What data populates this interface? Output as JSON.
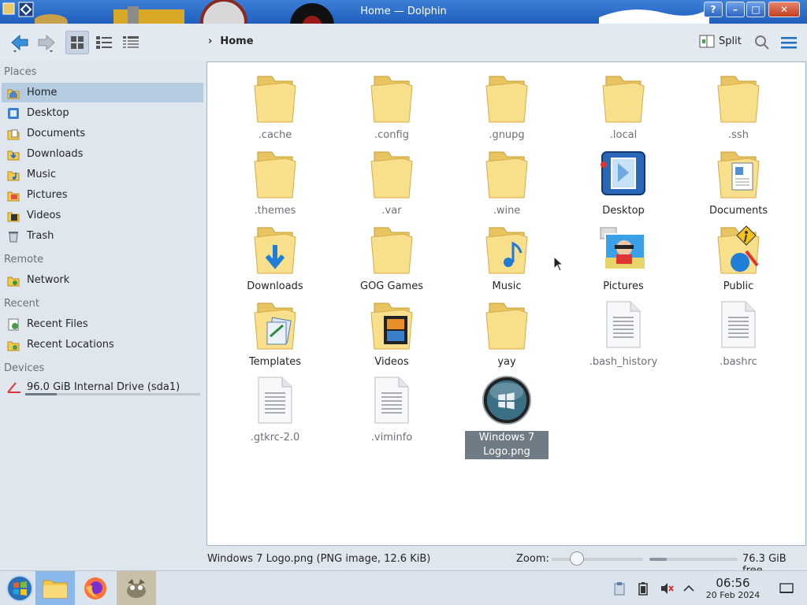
{
  "window": {
    "title": "Home — Dolphin",
    "help_btn": "?",
    "min_btn": "–",
    "max_btn": "□",
    "close_btn": "✕"
  },
  "toolbar": {
    "back_icon": "back-arrow-icon",
    "forward_icon": "forward-arrow-icon",
    "view_modes": [
      "icons-view",
      "compact-view",
      "details-view"
    ],
    "breadcrumb_sep": "›",
    "breadcrumb": "Home",
    "split_label": "Split",
    "search_icon": "search-icon",
    "menu_icon": "hamburger-menu-icon"
  },
  "sidebar": {
    "places_title": "Places",
    "places": [
      "Home",
      "Desktop",
      "Documents",
      "Downloads",
      "Music",
      "Pictures",
      "Videos",
      "Trash"
    ],
    "remote_title": "Remote",
    "remote": [
      "Network"
    ],
    "recent_title": "Recent",
    "recent": [
      "Recent Files",
      "Recent Locations"
    ],
    "devices_title": "Devices",
    "devices": [
      "96.0 GiB Internal Drive (sda1)"
    ],
    "drive_usage_fraction": 0.18
  },
  "files": [
    {
      "name": ".cache",
      "type": "folder",
      "hidden": true
    },
    {
      "name": ".config",
      "type": "folder",
      "hidden": true
    },
    {
      "name": ".gnupg",
      "type": "folder",
      "hidden": true
    },
    {
      "name": ".local",
      "type": "folder",
      "hidden": true
    },
    {
      "name": ".ssh",
      "type": "folder",
      "hidden": true
    },
    {
      "name": ".themes",
      "type": "folder",
      "hidden": true
    },
    {
      "name": ".var",
      "type": "folder",
      "hidden": true
    },
    {
      "name": ".wine",
      "type": "folder",
      "hidden": true
    },
    {
      "name": "Desktop",
      "type": "desktop",
      "hidden": false
    },
    {
      "name": "Documents",
      "type": "documents",
      "hidden": false
    },
    {
      "name": "Downloads",
      "type": "downloads",
      "hidden": false
    },
    {
      "name": "GOG Games",
      "type": "folder",
      "hidden": false
    },
    {
      "name": "Music",
      "type": "music",
      "hidden": false
    },
    {
      "name": "Pictures",
      "type": "pictures",
      "hidden": false
    },
    {
      "name": "Public",
      "type": "public",
      "hidden": false
    },
    {
      "name": "Templates",
      "type": "templates",
      "hidden": false
    },
    {
      "name": "Videos",
      "type": "videos",
      "hidden": false
    },
    {
      "name": "yay",
      "type": "folder",
      "hidden": false
    },
    {
      "name": ".bash_history",
      "type": "text",
      "hidden": true
    },
    {
      "name": ".bashrc",
      "type": "text",
      "hidden": true
    },
    {
      "name": ".gtkrc-2.0",
      "type": "text",
      "hidden": true
    },
    {
      "name": ".viminfo",
      "type": "text",
      "hidden": true
    },
    {
      "name": "Windows 7 Logo.png",
      "type": "image",
      "hidden": false,
      "selected": true
    }
  ],
  "statusbar": {
    "selection_info": "Windows 7 Logo.png (PNG image, 12.6 KiB)",
    "zoom_label": "Zoom:",
    "zoom_fraction": 0.28,
    "free_space": "76.3 GiB free",
    "used_fraction": 0.2
  },
  "taskbar": {
    "apps": [
      "start-menu",
      "file-manager",
      "firefox",
      "gimp"
    ],
    "tray": [
      "clipboard-icon",
      "battery-icon",
      "muted-speaker-icon",
      "expand-tray-icon"
    ],
    "time": "06:56",
    "date": "20 Feb 2024",
    "show_desktop_icon": "show-desktop-icon"
  },
  "colors": {
    "accent": "#3daee9",
    "folder": "#f6d77e",
    "selection": "#6f7c85",
    "titlebar": "#2a6ccc"
  }
}
